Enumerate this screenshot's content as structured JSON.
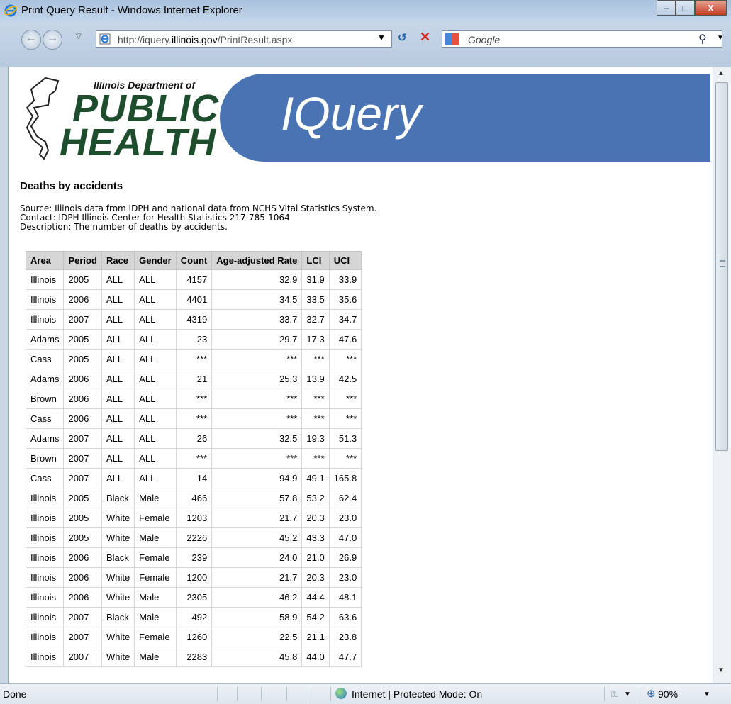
{
  "window": {
    "title": "Print Query Result - Windows Internet Explorer",
    "minimize": "–",
    "maximize": "□",
    "close": "X"
  },
  "address": {
    "url_prefix": "http://iquery.",
    "url_domain": "illinois.gov",
    "url_suffix": "/PrintResult.aspx"
  },
  "search": {
    "placeholder": "Google"
  },
  "banner": {
    "org_line": "Illinois Department of",
    "logo_word1": "PUBLIC",
    "logo_word2": "HEALTH",
    "product": "IQuery"
  },
  "report": {
    "title": "Deaths by accidents",
    "source": "Source: Illinois data from IDPH and national data from NCHS Vital Statistics System.",
    "contact": "Contact: IDPH Illinois Center for Health Statistics 217-785-1064",
    "description": "Description: The number of deaths by accidents."
  },
  "table": {
    "headers": [
      "Area",
      "Period",
      "Race",
      "Gender",
      "Count",
      "Age-adjusted Rate",
      "LCI",
      "UCI"
    ],
    "rows": [
      [
        "Illinois",
        "2005",
        "ALL",
        "ALL",
        "4157",
        "32.9",
        "31.9",
        "33.9"
      ],
      [
        "Illinois",
        "2006",
        "ALL",
        "ALL",
        "4401",
        "34.5",
        "33.5",
        "35.6"
      ],
      [
        "Illinois",
        "2007",
        "ALL",
        "ALL",
        "4319",
        "33.7",
        "32.7",
        "34.7"
      ],
      [
        "Adams",
        "2005",
        "ALL",
        "ALL",
        "23",
        "29.7",
        "17.3",
        "47.6"
      ],
      [
        "Cass",
        "2005",
        "ALL",
        "ALL",
        "***",
        "***",
        "***",
        "***"
      ],
      [
        "Adams",
        "2006",
        "ALL",
        "ALL",
        "21",
        "25.3",
        "13.9",
        "42.5"
      ],
      [
        "Brown",
        "2006",
        "ALL",
        "ALL",
        "***",
        "***",
        "***",
        "***"
      ],
      [
        "Cass",
        "2006",
        "ALL",
        "ALL",
        "***",
        "***",
        "***",
        "***"
      ],
      [
        "Adams",
        "2007",
        "ALL",
        "ALL",
        "26",
        "32.5",
        "19.3",
        "51.3"
      ],
      [
        "Brown",
        "2007",
        "ALL",
        "ALL",
        "***",
        "***",
        "***",
        "***"
      ],
      [
        "Cass",
        "2007",
        "ALL",
        "ALL",
        "14",
        "94.9",
        "49.1",
        "165.8"
      ],
      [
        "Illinois",
        "2005",
        "Black",
        "Male",
        "466",
        "57.8",
        "53.2",
        "62.4"
      ],
      [
        "Illinois",
        "2005",
        "White",
        "Female",
        "1203",
        "21.7",
        "20.3",
        "23.0"
      ],
      [
        "Illinois",
        "2005",
        "White",
        "Male",
        "2226",
        "45.2",
        "43.3",
        "47.0"
      ],
      [
        "Illinois",
        "2006",
        "Black",
        "Female",
        "239",
        "24.0",
        "21.0",
        "26.9"
      ],
      [
        "Illinois",
        "2006",
        "White",
        "Female",
        "1200",
        "21.7",
        "20.3",
        "23.0"
      ],
      [
        "Illinois",
        "2006",
        "White",
        "Male",
        "2305",
        "46.2",
        "44.4",
        "48.1"
      ],
      [
        "Illinois",
        "2007",
        "Black",
        "Male",
        "492",
        "58.9",
        "54.2",
        "63.6"
      ],
      [
        "Illinois",
        "2007",
        "White",
        "Female",
        "1260",
        "22.5",
        "21.1",
        "23.8"
      ],
      [
        "Illinois",
        "2007",
        "White",
        "Male",
        "2283",
        "45.8",
        "44.0",
        "47.7"
      ]
    ]
  },
  "status": {
    "left": "Done",
    "zone": "Internet | Protected Mode: On",
    "zoom": "90%"
  },
  "colors": {
    "iquery_band": "#4a73b4",
    "logo_green": "#1d4d2c",
    "table_header": "#d6d6d6"
  }
}
